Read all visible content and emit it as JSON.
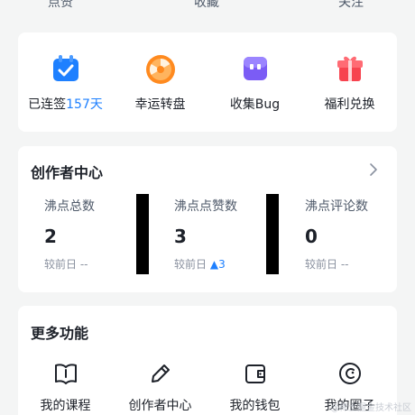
{
  "top_row": {
    "items": [
      "点赞",
      "收藏",
      "关注"
    ]
  },
  "quick_actions": [
    {
      "label_prefix": "已连签",
      "label_highlight": "157天",
      "icon": "calendar-check-icon"
    },
    {
      "label_prefix": "幸运转盘",
      "label_highlight": "",
      "icon": "lucky-wheel-icon"
    },
    {
      "label_prefix": "收集Bug",
      "label_highlight": "",
      "icon": "bug-collect-icon"
    },
    {
      "label_prefix": "福利兑换",
      "label_highlight": "",
      "icon": "gift-icon"
    }
  ],
  "creator_center": {
    "title": "创作者中心",
    "stats": [
      {
        "label": "沸点总数",
        "value": "2",
        "sub_prefix": "较前日",
        "sub_value": "--",
        "trend": ""
      },
      {
        "label": "沸点点赞数",
        "value": "3",
        "sub_prefix": "较前日",
        "sub_value": "3",
        "trend": "▲"
      },
      {
        "label": "沸点评论数",
        "value": "0",
        "sub_prefix": "较前日",
        "sub_value": "--",
        "trend": ""
      }
    ]
  },
  "more_functions": {
    "title": "更多功能",
    "items": [
      {
        "label": "我的课程",
        "icon": "book-icon"
      },
      {
        "label": "创作者中心",
        "icon": "pencil-icon"
      },
      {
        "label": "我的钱包",
        "icon": "wallet-icon"
      },
      {
        "label": "我的圈子",
        "icon": "circle-smile-icon"
      }
    ]
  },
  "colors": {
    "accent": "#1e80ff",
    "background": "#f4f5f5",
    "card": "#ffffff"
  },
  "watermark": "@稀土掘金技术社区"
}
